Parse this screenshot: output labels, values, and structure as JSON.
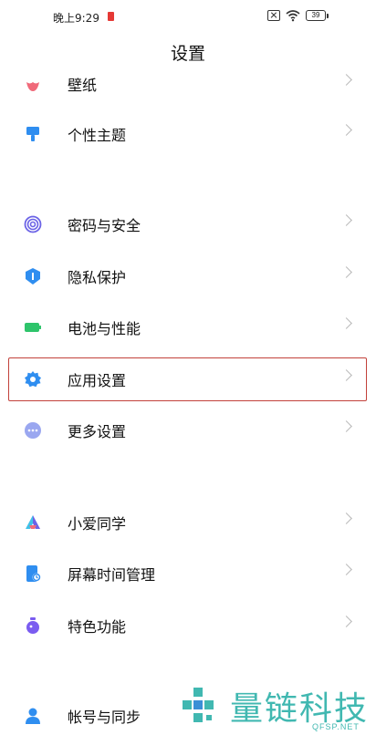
{
  "status_bar": {
    "time": "晚上9:29",
    "battery": "39"
  },
  "page": {
    "title": "设置"
  },
  "items": [
    {
      "label": "壁纸",
      "icon": "wallpaper-icon",
      "color": "#f06a7a"
    },
    {
      "label": "个性主题",
      "icon": "theme-brush-icon",
      "color": "#2f8ef0"
    },
    {
      "label": "密码与安全",
      "icon": "fingerprint-icon",
      "color": "#6b63e6"
    },
    {
      "label": "隐私保护",
      "icon": "privacy-shield-icon",
      "color": "#2f8ef0"
    },
    {
      "label": "电池与性能",
      "icon": "battery-icon",
      "color": "#2ec46b"
    },
    {
      "label": "应用设置",
      "icon": "gear-icon",
      "color": "#2f8ef0"
    },
    {
      "label": "更多设置",
      "icon": "more-dots-icon",
      "color": "#9aa7f0"
    },
    {
      "label": "小爱同学",
      "icon": "xiaoai-icon",
      "color": "#6b63e6"
    },
    {
      "label": "屏幕时间管理",
      "icon": "screen-time-icon",
      "color": "#2f8ef0"
    },
    {
      "label": "特色功能",
      "icon": "features-flask-icon",
      "color": "#7a5cf0"
    },
    {
      "label": "帐号与同步",
      "icon": "account-icon",
      "color": "#2f8ef0"
    }
  ],
  "highlighted_item": "应用设置",
  "watermark": {
    "text": "量链科技",
    "subtext": "QFSP.NET",
    "color": "#41b8b1"
  }
}
